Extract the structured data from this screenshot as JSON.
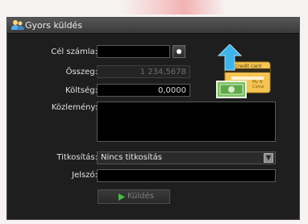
{
  "window": {
    "title": "Gyors küldés",
    "title_icon": "users-icon"
  },
  "form": {
    "target_account_label": "Cél számla:",
    "target_account_value": "",
    "amount_label": "Összeg:",
    "amount_value": "1 234,5678",
    "cost_label": "Költség:",
    "cost_value": "0,0000",
    "message_label": "Közlemény:",
    "message_value": "",
    "encryption_label": "Titkosítás:",
    "encryption_value": "Nincs titkosítás",
    "password_label": "Jelszó:",
    "password_value": "",
    "send_label": "Küldés"
  },
  "illustration": {
    "card_text": "Credit card",
    "card_icon": "credit-card-icon",
    "cash_icon": "banknote-icon",
    "arrow_icon": "arrow-up-icon"
  },
  "colors": {
    "panel_bg": "#1e1e1e",
    "accent_blue": "#3fb4e8",
    "send_green": "#3fbf3f"
  }
}
